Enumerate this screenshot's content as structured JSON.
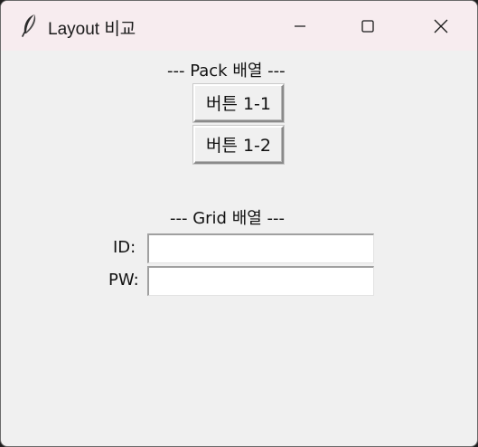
{
  "window": {
    "title": "Layout 비교",
    "app_icon": "feather-icon"
  },
  "controls": {
    "minimize_icon": "minimize-icon",
    "maximize_icon": "maximize-icon",
    "close_icon": "close-icon"
  },
  "pack_section": {
    "label": "--- Pack 배열 ---",
    "buttons": [
      "버튼 1-1",
      "버튼 1-2"
    ]
  },
  "grid_section": {
    "label": "--- Grid 배열 ---",
    "id_label": "ID:",
    "id_value": "",
    "pw_label": "PW:",
    "pw_value": ""
  },
  "colors": {
    "titlebar": "#f7ecef",
    "window_bg": "#f0f0f0"
  }
}
